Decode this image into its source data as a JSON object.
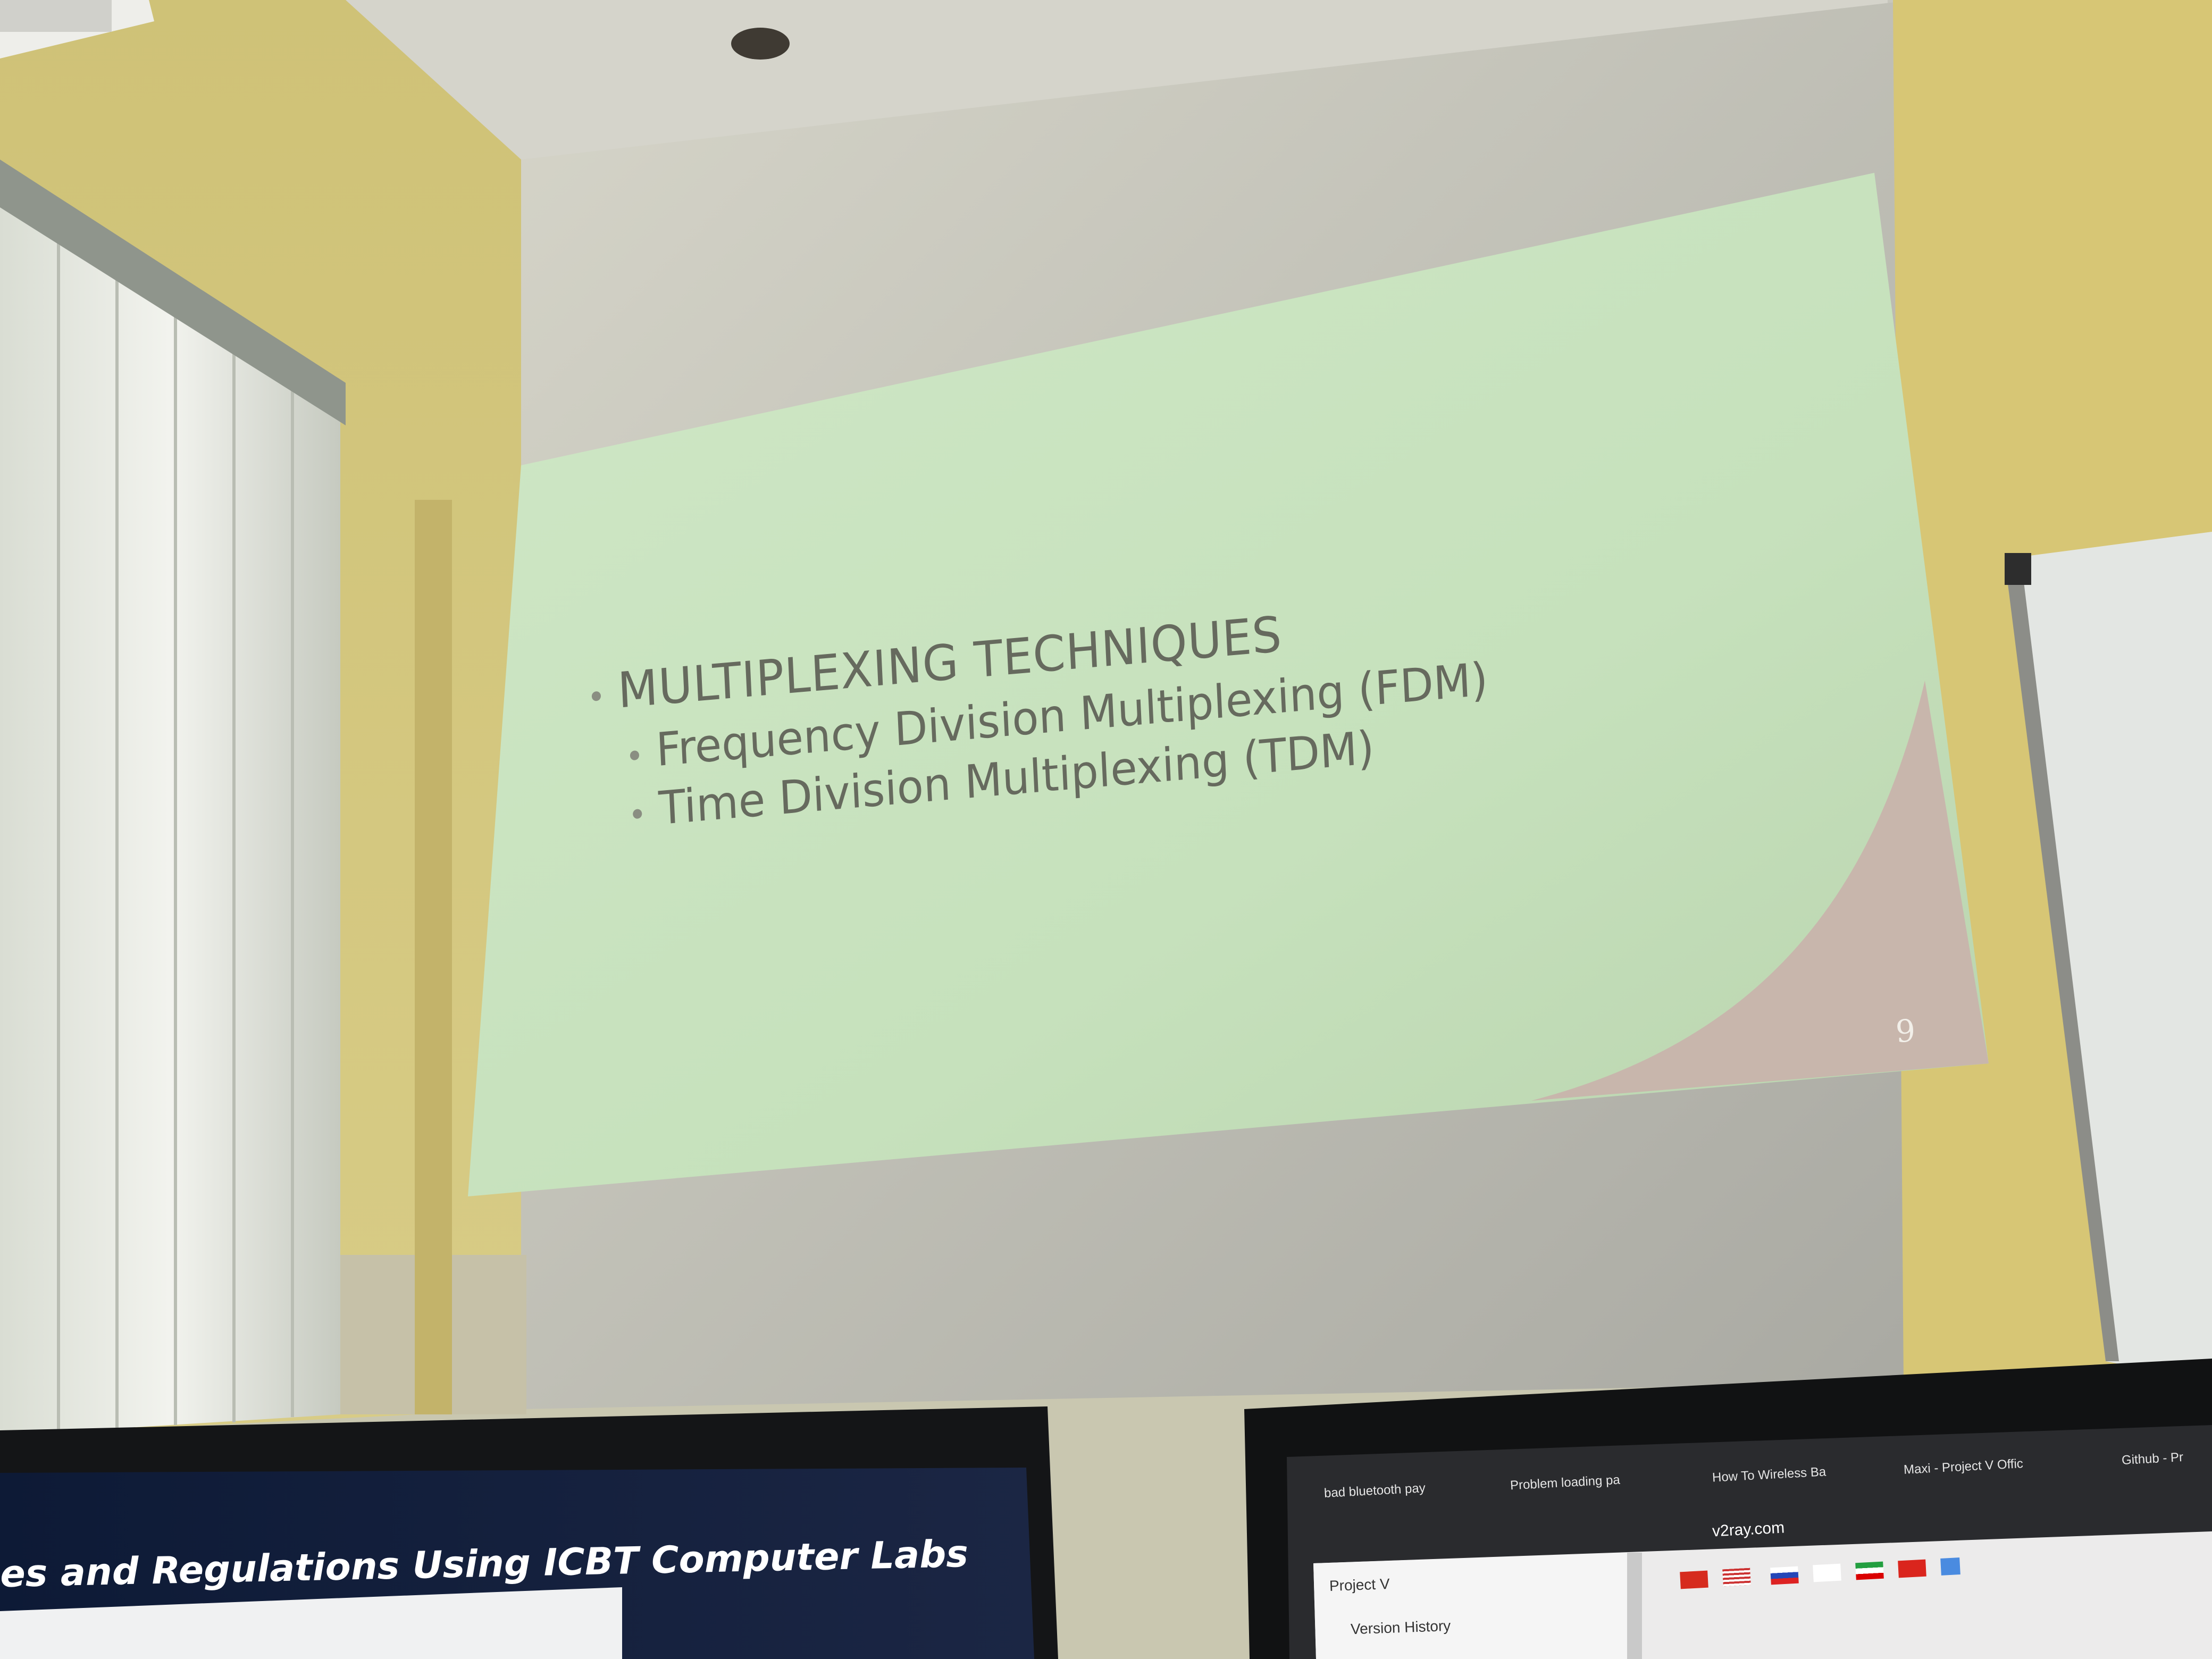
{
  "slide": {
    "heading": "MULTIPLEXING TECHNIQUES",
    "bullets": [
      "Frequency Division Multiplexing (FDM)",
      "Time Division Multiplexing (TDM)"
    ],
    "page_number": "9"
  },
  "left_monitor": {
    "title": "es and Regulations Using ICBT Computer Labs"
  },
  "right_monitor": {
    "tabs": [
      "bad bluetooth pay",
      "Problem loading pa",
      "How To Wireless Ba",
      "Maxi - Project V Offic",
      "Github - Pr"
    ],
    "address": "v2ray.com",
    "sidebar": {
      "project": "Project V",
      "version_history": "Version History"
    },
    "flag_icons": [
      "cn-flag-icon",
      "us-flag-icon",
      "ru-flag-icon",
      "kr-flag-icon",
      "ir-flag-icon",
      "vn-flag-icon",
      "translate-icon"
    ]
  },
  "colors": {
    "slide_background": "#c9e3c1",
    "slide_corner": "#c7b5ab",
    "slide_text": "#666a5e",
    "wall": "#c4c3b8",
    "yellow_wall": "#d2c874"
  }
}
